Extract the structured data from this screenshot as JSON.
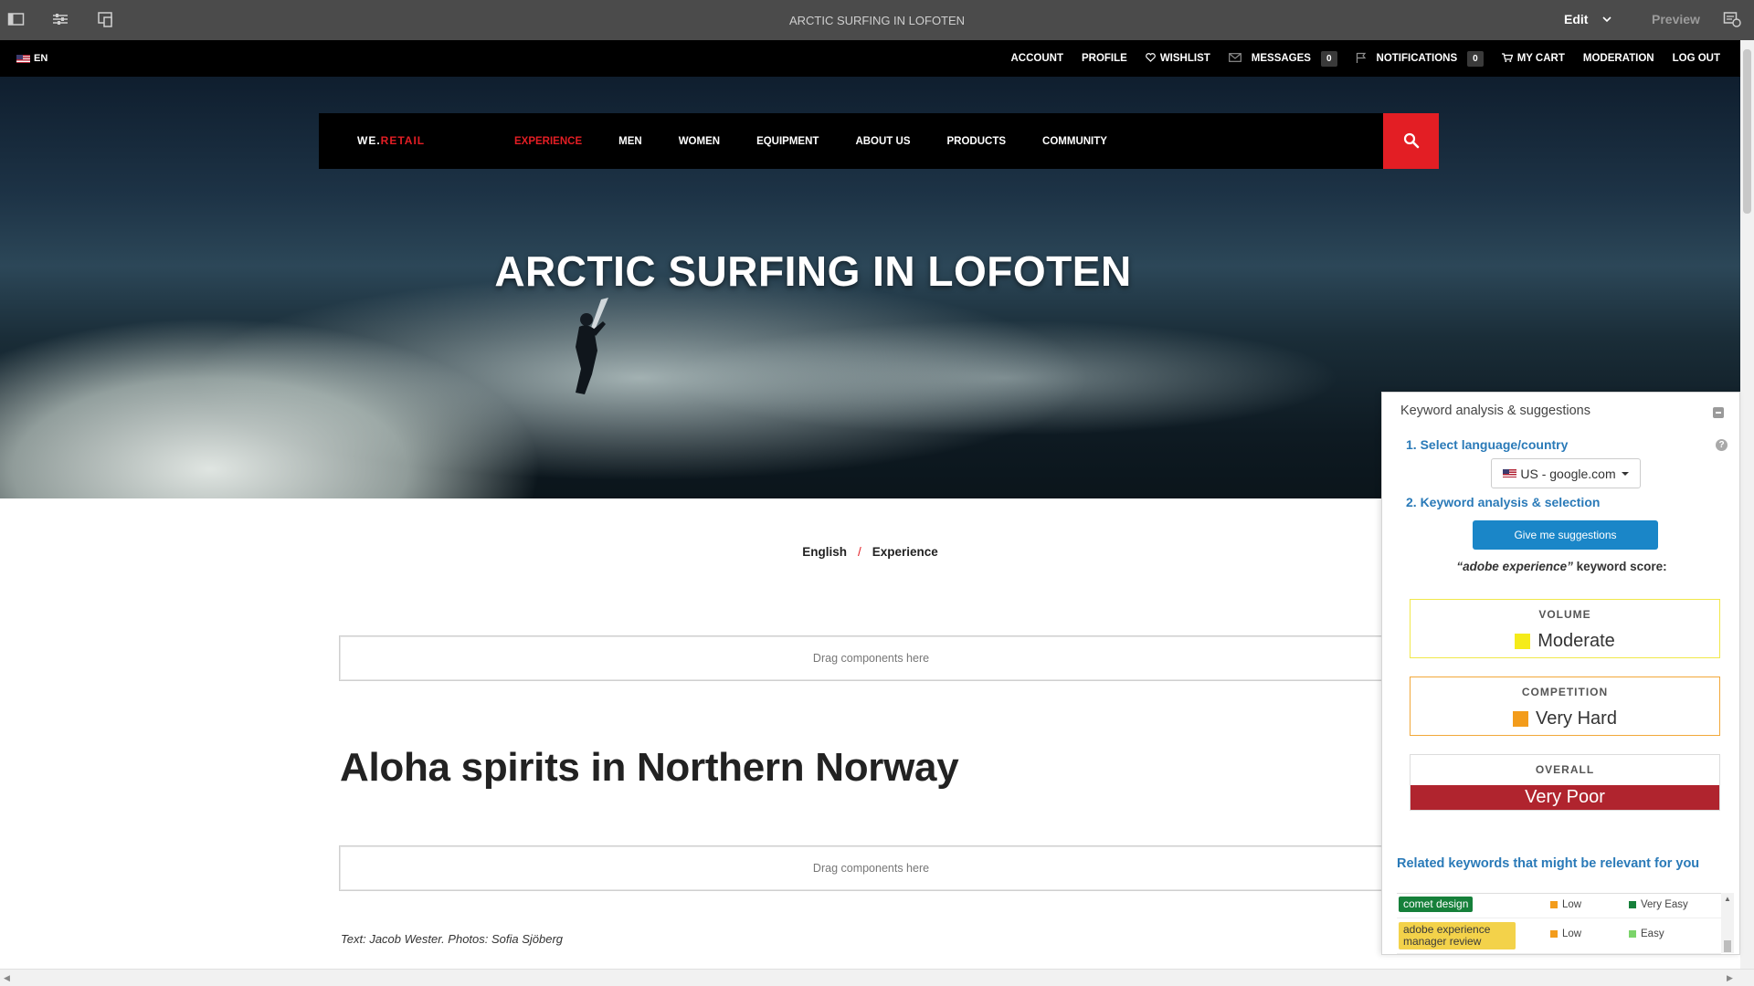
{
  "editor": {
    "page_title": "ARCTIC SURFING IN LOFOTEN",
    "mode": "Edit",
    "preview": "Preview"
  },
  "site": {
    "language": "EN",
    "top_nav": {
      "account": "ACCOUNT",
      "profile": "PROFILE",
      "wishlist": "WISHLIST",
      "messages": "MESSAGES",
      "messages_count": "0",
      "notifications": "NOTIFICATIONS",
      "notifications_count": "0",
      "cart": "MY CART",
      "moderation": "MODERATION",
      "logout": "LOG OUT"
    },
    "logo": {
      "part1": "WE.",
      "part2": "RETAIL"
    },
    "main_nav": [
      "EXPERIENCE",
      "MEN",
      "WOMEN",
      "EQUIPMENT",
      "ABOUT US",
      "PRODUCTS",
      "COMMUNITY"
    ],
    "active_nav": "EXPERIENCE",
    "accent_color": "#e31e24"
  },
  "hero": {
    "title": "ARCTIC SURFING IN LOFOTEN"
  },
  "breadcrumb": {
    "items": [
      "English",
      "Experience"
    ],
    "separator": "/"
  },
  "content": {
    "dropzone_text": "Drag components here",
    "article_title": "Aloha spirits in Northern Norway",
    "credits": "Text: Jacob Wester. Photos: Sofia Sjöberg"
  },
  "seo_panel": {
    "title": "Keyword analysis & suggestions",
    "step1": "1. Select language/country",
    "locale": "US - google.com",
    "step2": "2. Keyword analysis & selection",
    "suggest_button": "Give me suggestions",
    "score_keyword": "“adobe experience”",
    "score_suffix": " keyword score:",
    "metrics": {
      "volume": {
        "label": "VOLUME",
        "value": "Moderate",
        "color": "#f5eb1a"
      },
      "competition": {
        "label": "COMPETITION",
        "value": "Very Hard",
        "color": "#f39c1b"
      },
      "overall": {
        "label": "OVERALL",
        "value": "Very Poor",
        "color": "#b0242e"
      }
    },
    "related_title": "Related keywords that might be relevant for you",
    "related": [
      {
        "keyword": "comet design",
        "volume": "Low",
        "difficulty": "Very Easy",
        "tag_color": "#16803a",
        "volume_color": "#f39c1b",
        "difficulty_color": "#16803a"
      },
      {
        "keyword": "adobe experience manager review",
        "volume": "Low",
        "difficulty": "Easy",
        "tag_color": "#f3d24a",
        "volume_color": "#f39c1b",
        "difficulty_color": "#7bd46a"
      }
    ]
  }
}
